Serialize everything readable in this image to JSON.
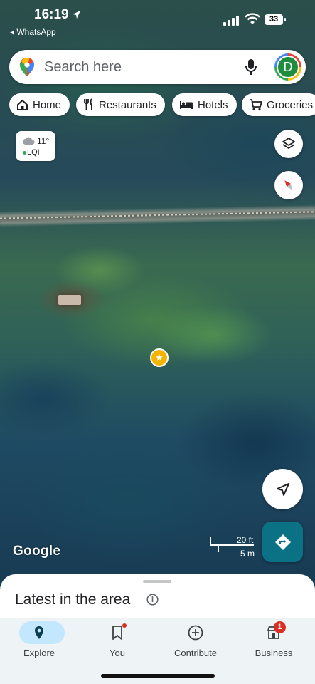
{
  "status_bar": {
    "time": "16:19",
    "back_app": "◂ WhatsApp",
    "battery": "33"
  },
  "search": {
    "placeholder": "Search here",
    "avatar_initial": "D"
  },
  "chips": [
    {
      "label": "Home",
      "icon": "home-icon"
    },
    {
      "label": "Restaurants",
      "icon": "restaurant-icon"
    },
    {
      "label": "Hotels",
      "icon": "hotel-icon"
    },
    {
      "label": "Groceries",
      "icon": "cart-icon"
    }
  ],
  "weather": {
    "temp": "11°",
    "air_quality": "LQI"
  },
  "map": {
    "brand": "Google",
    "scale_imperial": "20 ft",
    "scale_metric": "5 m"
  },
  "sheet": {
    "title": "Latest in the area"
  },
  "nav": [
    {
      "label": "Explore",
      "active": true
    },
    {
      "label": "You",
      "badge_dot": true
    },
    {
      "label": "Contribute"
    },
    {
      "label": "Business",
      "badge_count": "1"
    }
  ],
  "colors": {
    "accent_teal": "#0b7285",
    "nav_active_pill": "#c2e7ff",
    "badge_red": "#d93025",
    "marker_yellow": "#f4b400"
  }
}
